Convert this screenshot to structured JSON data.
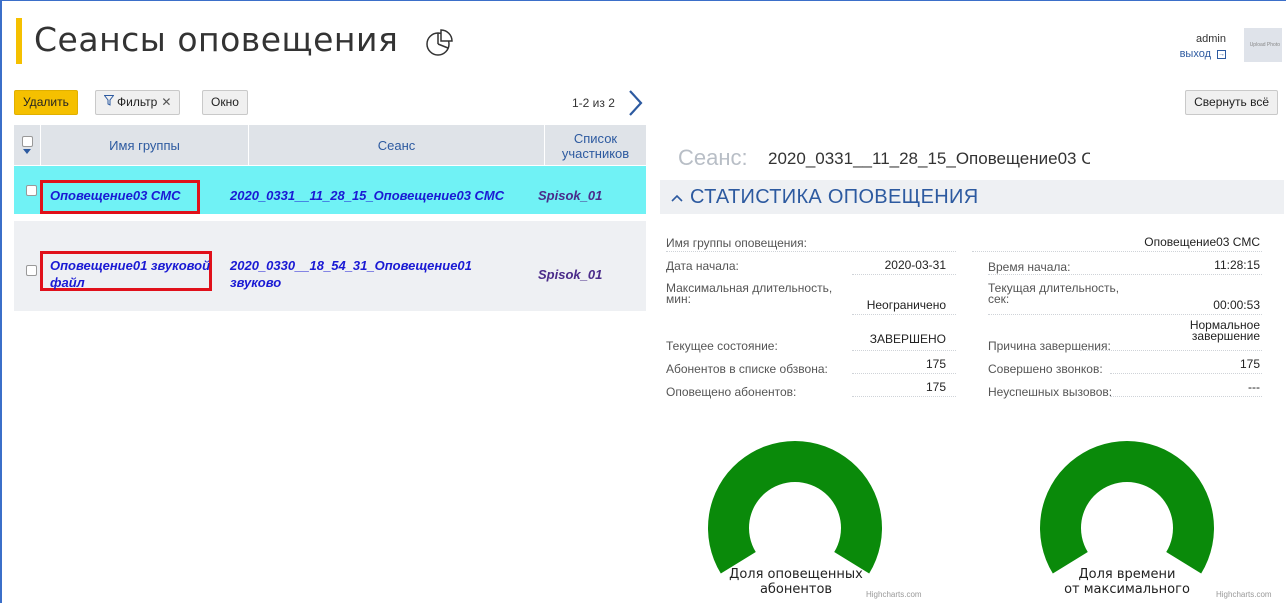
{
  "header": {
    "title": "Сеансы оповещения",
    "pie_icon": "pie-chart-icon",
    "user": "admin",
    "logout": "выход",
    "avatar_text": "Upload Photo"
  },
  "toolbar": {
    "delete_label": "Удалить",
    "filter_label": "Фильтр",
    "filter_clear": "✕",
    "window_label": "Окно",
    "pager": "1-2 из 2",
    "collapse_label": "Свернуть всё"
  },
  "table": {
    "columns": [
      "Имя группы",
      "Сеанс",
      "Список участников"
    ],
    "rows": [
      {
        "group": "Оповещение03 СМС",
        "session": "2020_0331__11_28_15_Оповещение03 СМС",
        "list": "Spisok_01"
      },
      {
        "group_line1": "Оповещение01 звуковой",
        "group_line2": "файл",
        "session_line1": "2020_0330__18_54_31_Оповещение01",
        "session_line2": "звуково",
        "list": "Spisok_01"
      }
    ]
  },
  "details": {
    "session_label": "Сеанс:",
    "session_value": "2020_0331__11_28_15_Оповещение03 С",
    "section_title": "СТАТИСТИКА ОПОВЕЩЕНИЯ",
    "group_name_label": "Имя группы оповещения:",
    "group_name_value": "Оповещение03 СМС",
    "start_date_label": "Дата начала:",
    "start_date_value": "2020-03-31",
    "start_time_label": "Время начала:",
    "start_time_value": "11:28:15",
    "max_duration_label_1": "Максимальная длительность,",
    "max_duration_label_2": "мин:",
    "max_duration_value": "Неограничено",
    "cur_duration_label_1": "Текущая длительность,",
    "cur_duration_label_2": "сек:",
    "cur_duration_value": "00:00:53",
    "state_label": "Текущее состояние:",
    "state_value": "ЗАВЕРШЕНО",
    "reason_label": "Причина завершения:",
    "reason_value_1": "Нормальное",
    "reason_value_2": "завершение",
    "subscribers_label": "Абонентов в списке обзвона:",
    "subscribers_value": "175",
    "calls_label": "Совершено звонков:",
    "calls_value": "175",
    "notified_label": "Оповещено абонентов:",
    "notified_value": "175",
    "failed_label": "Неуспешных вызовов:",
    "failed_value": "---"
  },
  "gauges": [
    {
      "label_1": "Доля оповещенных",
      "label_2": "абонентов",
      "fraction": 1.0,
      "color": "#0a8a0a"
    },
    {
      "label_1": "Доля времени",
      "label_2": "от максимального",
      "fraction": 1.0,
      "color": "#0a8a0a"
    }
  ],
  "credit": "Highcharts.com",
  "colors": {
    "accent": "#f5c000",
    "selected_row": "#70f2f5",
    "highlight_box": "#e0101a",
    "link": "#2d5aa0"
  }
}
